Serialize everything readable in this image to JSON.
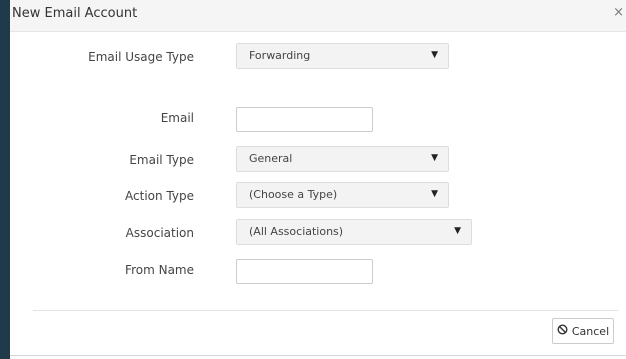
{
  "dialog": {
    "title": "New Email Account",
    "close_glyph": "×"
  },
  "form": {
    "usage_type": {
      "label": "Email Usage Type",
      "value": "Forwarding"
    },
    "email": {
      "label": "Email",
      "value": ""
    },
    "email_type": {
      "label": "Email Type",
      "value": "General"
    },
    "action_type": {
      "label": "Action Type",
      "value": "(Choose a Type)"
    },
    "association": {
      "label": "Association",
      "value": "(All Associations)"
    },
    "from_name": {
      "label": "From Name",
      "value": ""
    }
  },
  "footer": {
    "cancel_label": "Cancel"
  },
  "icons": {
    "caret": "chevron-down-icon",
    "cancel": "ban-icon"
  },
  "colors": {
    "sidebar": "#1f3a4a",
    "header_bg": "#f5f5f5",
    "select_bg": "#f3f3f3"
  }
}
